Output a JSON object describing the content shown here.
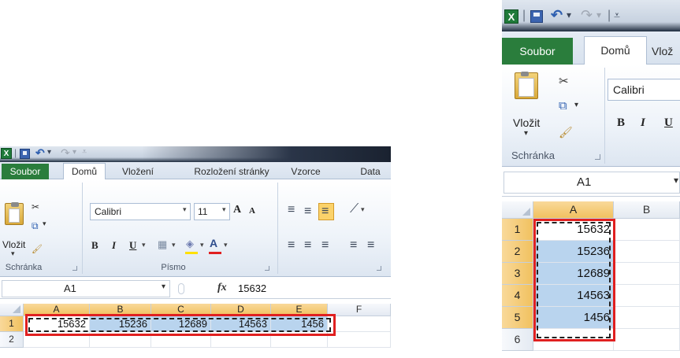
{
  "colors": {
    "file_tab": "#2a7d3c",
    "selection": "#b9d4ee",
    "highlight_box": "#e02020",
    "header_selected": "#f1c15f"
  },
  "app": {
    "logo_letter": "X",
    "undo_icon": "↶",
    "redo_icon": "↷",
    "separator": "|",
    "dropdown_glyph": "▾",
    "qat_more_glyph": "⩡"
  },
  "left": {
    "tabs": {
      "file": "Soubor",
      "home": "Domů",
      "insert": "Vložení",
      "page_layout": "Rozložení stránky",
      "formulas": "Vzorce",
      "data": "Data"
    },
    "clipboard": {
      "paste": "Vložit",
      "group_label": "Schránka",
      "cut_icon": "✂",
      "copy_icon": "⧉",
      "brush_icon": "🖌"
    },
    "font": {
      "name": "Calibri",
      "size": "11",
      "grow": "A",
      "shrink": "A",
      "bold": "B",
      "italic": "I",
      "underline": "U",
      "group_label": "Písmo",
      "border_icon": "▦",
      "fill_icon": "◈",
      "color_letter": "A"
    },
    "align": {
      "icon_top": "≡",
      "icon_mid": "≡",
      "icon_bot": "≡",
      "orient": "⟋"
    },
    "formula_bar": {
      "name_box": "A1",
      "fx": "fx",
      "value": "15632"
    },
    "grid": {
      "columns": [
        "A",
        "B",
        "C",
        "D",
        "E",
        "F"
      ],
      "rows": [
        "1",
        "2"
      ],
      "row1": [
        "15632",
        "15236",
        "12689",
        "14563",
        "1456"
      ]
    }
  },
  "right": {
    "tabs": {
      "file": "Soubor",
      "home": "Domů",
      "insert": "Vlož"
    },
    "clipboard": {
      "paste": "Vložit",
      "group_label": "Schránka"
    },
    "font": {
      "name": "Calibri",
      "bold": "B",
      "italic": "I",
      "underline": "U"
    },
    "formula_bar": {
      "name_box": "A1"
    },
    "grid": {
      "columns": [
        "A",
        "B"
      ],
      "rows": [
        "1",
        "2",
        "3",
        "4",
        "5",
        "6"
      ],
      "colA": [
        "15632",
        "15236",
        "12689",
        "14563",
        "1456"
      ]
    }
  }
}
